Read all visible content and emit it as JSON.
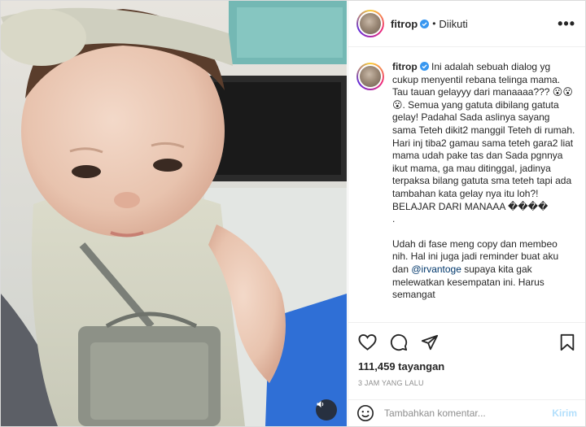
{
  "post": {
    "username": "fitrop",
    "follow_status": "Diikuti",
    "more_label": "•••",
    "caption_username": "fitrop",
    "caption_paragraphs": [
      "Ini adalah sebuah dialog yg cukup menyentil rebana telinga mama. Tau tauan gelayyy dari manaaaa??? 😮😮😮. Semua yang gatuta dibilang gatuta gelay! Padahal Sada aslinya sayang sama Teteh dikit2 manggil Teteh di rumah. Hari inj tiba2 gamau sama teteh gara2 liat mama udah pake tas dan Sada pgnnya ikut mama, ga mau ditinggal, jadinya terpaksa bilang gatuta sma teteh tapi ada tambahan kata gelay nya itu loh?! BELAJAR DARI MANAAA ����",
      "."
    ],
    "caption_tail_before": "Udah di fase meng copy dan membeo nih. Hal ini juga jadi reminder buat aku dan ",
    "caption_mention": "@irvantoge",
    "caption_tail_after": " supaya kita gak melewatkan kesempatan ini. Harus semangat",
    "views": "111,459 tayangan",
    "time_ago": "3 JAM YANG LALU",
    "comment_placeholder": "Tambahkan komentar...",
    "post_label": "Kirim"
  },
  "colors": {
    "verified": "#3897f0",
    "post_button": "#b2dffc",
    "mention": "#00376b"
  },
  "icons": [
    "like-icon",
    "comment-icon",
    "share-icon",
    "save-icon",
    "emoji-icon",
    "sound-icon",
    "verified-icon",
    "more-options-icon"
  ]
}
